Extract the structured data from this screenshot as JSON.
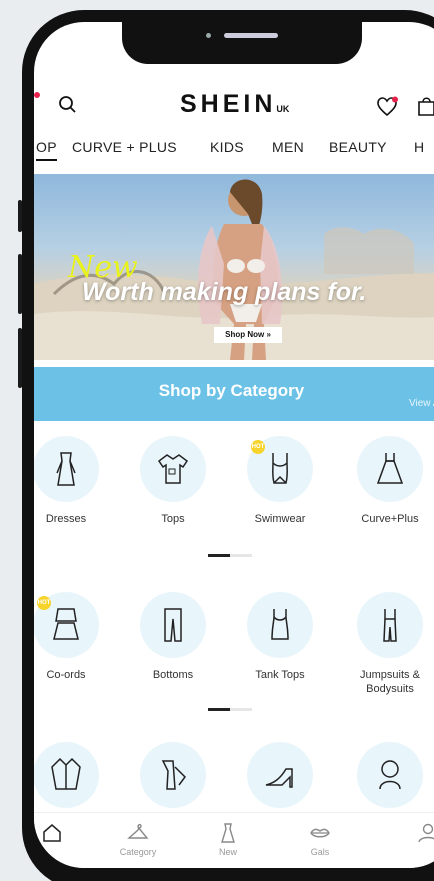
{
  "header": {
    "logo": "SHEIN",
    "logo_region": "UK",
    "icons": [
      "search-icon",
      "wishlist-heart-icon",
      "bag-icon",
      "menu-icon"
    ]
  },
  "nav_tabs": [
    {
      "label": "OP",
      "active": true
    },
    {
      "label": "CURVE + PLUS",
      "active": false
    },
    {
      "label": "KIDS",
      "active": false
    },
    {
      "label": "MEN",
      "active": false
    },
    {
      "label": "BEAUTY",
      "active": false
    },
    {
      "label": "H",
      "active": false
    }
  ],
  "banner": {
    "script_text": "New",
    "headline": "Worth making plans for.",
    "cta": "Shop Now »"
  },
  "category_section": {
    "title": "Shop by Category",
    "view_all": "View AL"
  },
  "categories_row1": [
    {
      "label": "Dresses",
      "icon": "dress-icon",
      "hot": false
    },
    {
      "label": "Tops",
      "icon": "tshirt-icon",
      "hot": false
    },
    {
      "label": "Swimwear",
      "icon": "swimsuit-icon",
      "hot": true
    },
    {
      "label": "Curve+Plus",
      "icon": "curve-dress-icon",
      "hot": false
    }
  ],
  "categories_row2": [
    {
      "label": "Co-ords",
      "icon": "coords-icon",
      "hot": true
    },
    {
      "label": "Bottoms",
      "icon": "trousers-icon",
      "hot": false
    },
    {
      "label": "Tank Tops",
      "icon": "tank-top-icon",
      "hot": false
    },
    {
      "label": "Jumpsuits &",
      "label2": "Bodysuits",
      "icon": "jumpsuit-icon",
      "hot": false
    }
  ],
  "categories_row3": [
    {
      "icon": "jacket-icon"
    },
    {
      "icon": "jeans-icon"
    },
    {
      "icon": "heel-shoe-icon"
    },
    {
      "icon": "accessories-icon"
    }
  ],
  "hot_badge": "HOT",
  "pager": {
    "current": 1,
    "total": 2
  },
  "bottom_nav": [
    {
      "label": "",
      "icon": "home-icon"
    },
    {
      "label": "Category",
      "icon": "hanger-icon"
    },
    {
      "label": "New",
      "icon": "new-dress-icon"
    },
    {
      "label": "Gals",
      "icon": "lips-icon"
    },
    {
      "label": "",
      "icon": "profile-icon"
    }
  ],
  "colors": {
    "accent_blue": "#6cc2e6",
    "circle_bg": "#e8f5fb",
    "notification_dot": "#e6224b",
    "banner_script": "#e9f21a"
  }
}
